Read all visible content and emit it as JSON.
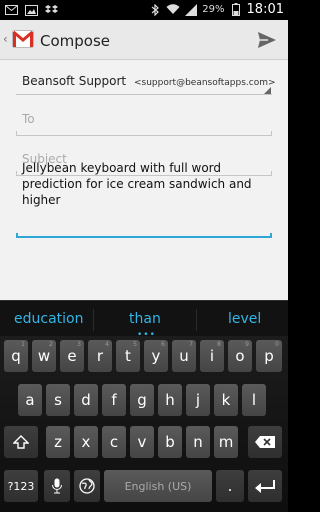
{
  "status": {
    "battery_percent": "29%",
    "time": "18:01"
  },
  "actionbar": {
    "title": "Compose"
  },
  "compose": {
    "from_name": "Beansoft Support",
    "from_email": "<support@beansoftapps.com>",
    "to_placeholder": "To",
    "subject_placeholder": "Subject",
    "body": "Jellybean keyboard with full word prediction for ice cream sandwich and higher"
  },
  "keyboard": {
    "suggestions": [
      "education",
      "than",
      "level"
    ],
    "row1": [
      {
        "label": "q",
        "sup": "1"
      },
      {
        "label": "w",
        "sup": "2"
      },
      {
        "label": "e",
        "sup": "3"
      },
      {
        "label": "r",
        "sup": "4"
      },
      {
        "label": "t",
        "sup": "5"
      },
      {
        "label": "y",
        "sup": "6"
      },
      {
        "label": "u",
        "sup": "7"
      },
      {
        "label": "i",
        "sup": "8"
      },
      {
        "label": "o",
        "sup": "9"
      },
      {
        "label": "p",
        "sup": "0"
      }
    ],
    "row2": [
      "a",
      "s",
      "d",
      "f",
      "g",
      "h",
      "j",
      "k",
      "l"
    ],
    "row3": [
      "z",
      "x",
      "c",
      "v",
      "b",
      "n",
      "m"
    ],
    "mode_key": "?123",
    "space_label": "English (US)",
    "period_key": "."
  }
}
